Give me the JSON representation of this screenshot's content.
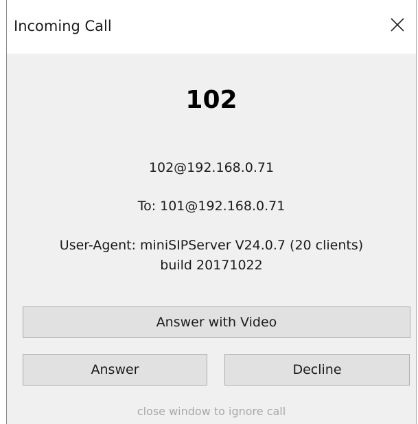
{
  "window": {
    "title": "Incoming Call",
    "close_icon": "close-icon"
  },
  "call": {
    "caller_name": "102",
    "caller_uri": "102@192.168.0.71",
    "to_line": "To: 101@192.168.0.71",
    "user_agent_line1": "User-Agent: miniSIPServer V24.0.7 (20 clients)",
    "user_agent_line2": "build 20171022"
  },
  "buttons": {
    "answer_video": "Answer with Video",
    "answer": "Answer",
    "decline": "Decline"
  },
  "footer": {
    "hint": "close window to ignore call"
  }
}
